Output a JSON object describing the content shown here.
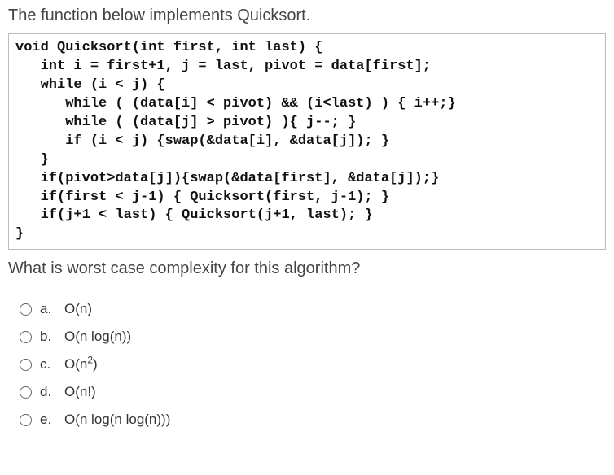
{
  "intro": "The function below implements Quicksort.",
  "code": "void Quicksort(int first, int last) {\n   int i = first+1, j = last, pivot = data[first];\n   while (i < j) {\n      while ( (data[i] < pivot) && (i<last) ) { i++;}\n      while ( (data[j] > pivot) ){ j--; }\n      if (i < j) {swap(&data[i], &data[j]); }\n   }\n   if(pivot>data[j]){swap(&data[first], &data[j]);}\n   if(first < j-1) { Quicksort(first, j-1); }\n   if(j+1 < last) { Quicksort(j+1, last); }\n}",
  "question": "What is worst case complexity for this algorithm?",
  "options": [
    {
      "letter": "a.",
      "text": "O(n)"
    },
    {
      "letter": "b.",
      "text": "O(n log(n))"
    },
    {
      "letter": "c.",
      "text": "O(n²)"
    },
    {
      "letter": "d.",
      "text": "O(n!)"
    },
    {
      "letter": "e.",
      "text": "O(n log(n log(n)))"
    }
  ]
}
